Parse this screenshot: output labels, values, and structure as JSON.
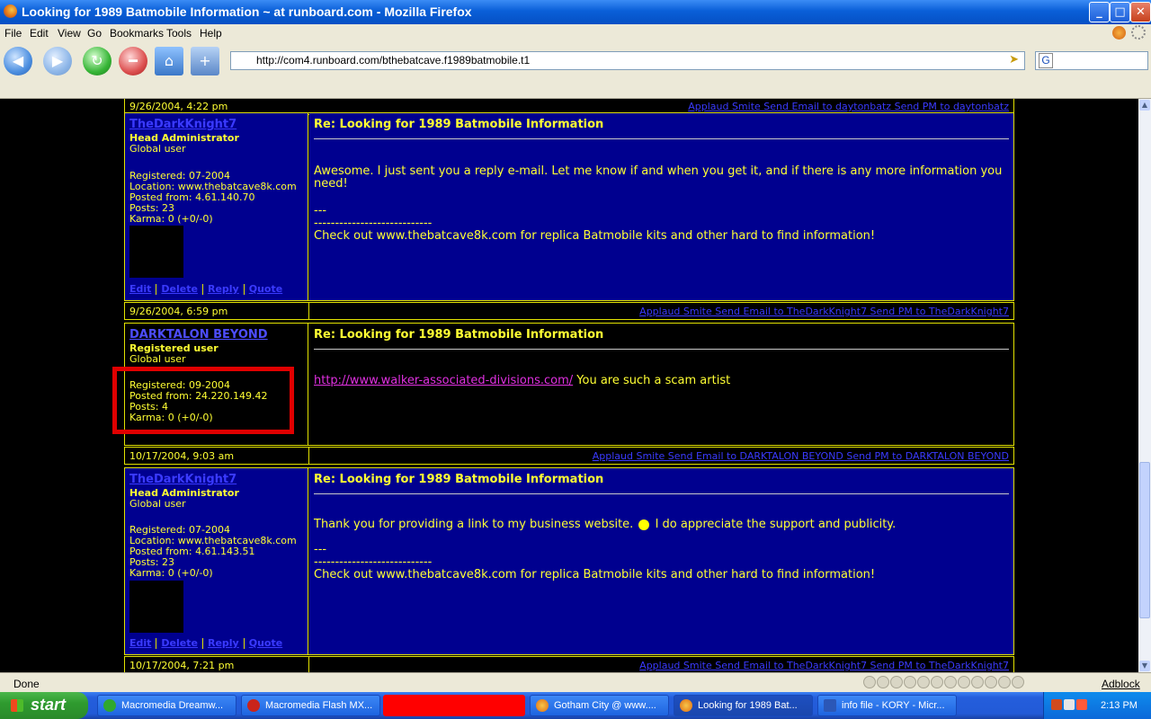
{
  "window": {
    "title": "Looking for 1989 Batmobile Information ~ at runboard.com - Mozilla Firefox",
    "controls": {
      "minimize": "_",
      "maximize": "□",
      "close": "✕"
    }
  },
  "menu": [
    "File",
    "Edit",
    "View",
    "Go",
    "Bookmarks",
    "Tools",
    "Help"
  ],
  "toolbar": {
    "url": "http://com4.runboard.com/bthebatcave.f1989batmobile.t1",
    "search_engine_letter": "G"
  },
  "forum": {
    "posts": [
      {
        "date": "9/26/2004, 4:22 pm",
        "links": "Applaud Smite Send Email to daytonbatz  Send PM to daytonbatz"
      },
      {
        "user": "TheDarkKnight7",
        "rank": "Head Administrator",
        "group": "Global user",
        "stats": [
          "Registered: 07-2004",
          "Location: www.thebatcave8k.com",
          "Posted from: 4.61.140.70",
          "Posts: 23",
          "Karma: 0 (+0/-0)"
        ],
        "actions": [
          "Edit",
          "Delete",
          "Reply",
          "Quote"
        ],
        "subject": "Re: Looking for 1989 Batmobile Information",
        "body": [
          "Awesome. I just sent you a reply e-mail. Let me know if and when you get it, and if there is any more information you need!",
          "---",
          "----------------------------",
          "Check out www.thebatcave8k.com for replica Batmobile kits and other hard to find information!"
        ],
        "date": "9/26/2004, 6:59 pm",
        "links": "Applaud Smite Send Email to TheDarkKnight7  Send PM to TheDarkKnight7"
      },
      {
        "user": "DARKTALON BEYOND",
        "rank": "Registered user",
        "group": "Global user",
        "stats": [
          "Registered: 09-2004",
          "Posted from: 24.220.149.42",
          "Posts: 4",
          "Karma: 0 (+0/-0)"
        ],
        "subject": "Re: Looking for 1989 Batmobile Information",
        "link": "http://www.walker-associated-divisions.com/",
        "body_after_link": " You are such a scam artist",
        "date": "10/17/2004, 9:03 am",
        "links": "Applaud Smite Send Email to DARKTALON BEYOND  Send PM to DARKTALON BEYOND"
      },
      {
        "user": "TheDarkKnight7",
        "rank": "Head Administrator",
        "group": "Global user",
        "stats": [
          "Registered: 07-2004",
          "Location: www.thebatcave8k.com",
          "Posted from: 4.61.143.51",
          "Posts: 23",
          "Karma: 0 (+0/-0)"
        ],
        "actions": [
          "Edit",
          "Delete",
          "Reply",
          "Quote"
        ],
        "subject": "Re: Looking for 1989 Batmobile Information",
        "body_line1_before": "Thank you for providing a link to my business website.",
        "body_line1_after": " I do appreciate the support and publicity.",
        "body": [
          "---",
          "----------------------------",
          "Check out www.thebatcave8k.com for replica Batmobile kits and other hard to find information!"
        ],
        "date": "10/17/2004, 7:21 pm",
        "links": "Applaud Smite Send Email to TheDarkKnight7  Send PM to TheDarkKnight7"
      }
    ]
  },
  "status": {
    "text": "Done",
    "adblock": "Adblock"
  },
  "taskbar": {
    "start": "start",
    "tasks": [
      "Macromedia Dreamw...",
      "Macromedia Flash MX...",
      "",
      "Gotham City @ www....",
      "Looking for 1989 Bat...",
      "info file - KORY - Micr..."
    ],
    "clock": "2:13 PM"
  },
  "colors": {
    "post_bg": "#00008f",
    "text": "#ffff33",
    "link": "#3a3aff",
    "border": "#e2e200",
    "highlight_box": "#e00000"
  }
}
